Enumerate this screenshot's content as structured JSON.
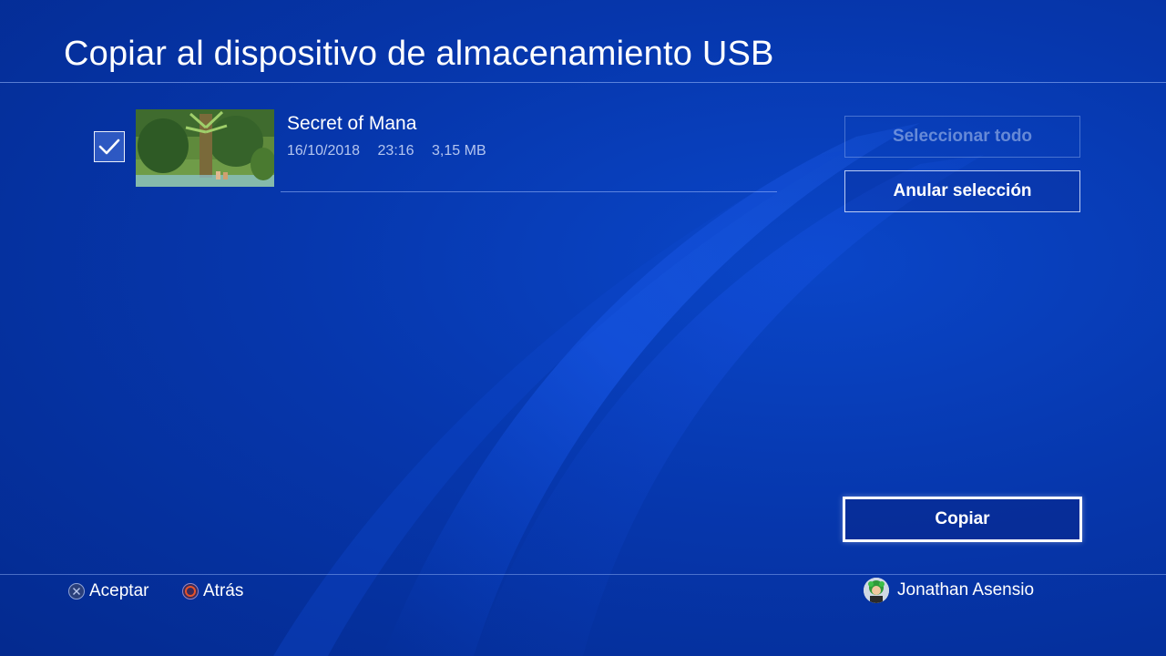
{
  "header": {
    "title": "Copiar al dispositivo de almacenamiento USB"
  },
  "items": [
    {
      "title": "Secret of Mana",
      "date": "16/10/2018",
      "time": "23:16",
      "size": "3,15 MB",
      "checked": true
    }
  ],
  "buttons": {
    "select_all": "Seleccionar todo",
    "deselect": "Anular selección",
    "copy": "Copiar"
  },
  "footer": {
    "accept_label": "Aceptar",
    "back_label": "Atrás",
    "user_name": "Jonathan Asensio"
  },
  "icons": {
    "checkbox": "check-icon",
    "accept": "cross-button-icon",
    "back": "circle-button-icon",
    "user": "avatar"
  },
  "colors": {
    "background": "#0637ad",
    "accent_circle": "#e8532a",
    "text": "#ffffff"
  }
}
